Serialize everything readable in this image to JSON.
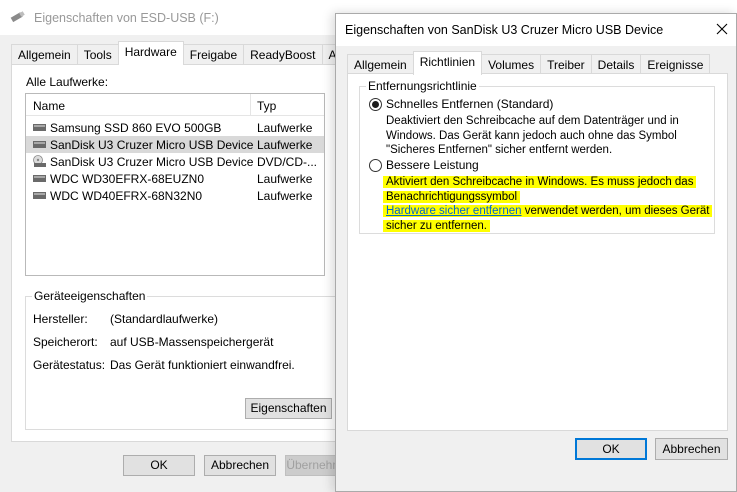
{
  "back_window": {
    "title": "Eigenschaften von ESD-USB (F:)",
    "tabs": [
      "Allgemein",
      "Tools",
      "Hardware",
      "Freigabe",
      "ReadyBoost",
      "Anpasse"
    ],
    "active_tab": "Hardware",
    "drives_label": "Alle Laufwerke:",
    "columns": [
      "Name",
      "Typ"
    ],
    "drives": [
      {
        "name": "Samsung SSD 860 EVO 500GB",
        "type": "Laufwerke",
        "icon": "drive-icon"
      },
      {
        "name": "SanDisk U3 Cruzer Micro USB Device",
        "type": "Laufwerke",
        "icon": "drive-icon",
        "selected": true
      },
      {
        "name": "SanDisk U3 Cruzer Micro USB Device",
        "type": "DVD/CD-...",
        "icon": "cd-drive-icon"
      },
      {
        "name": "WDC WD30EFRX-68EUZN0",
        "type": "Laufwerke",
        "icon": "drive-icon"
      },
      {
        "name": "WDC WD40EFRX-68N32N0",
        "type": "Laufwerke",
        "icon": "drive-icon"
      }
    ],
    "device_props": {
      "title": "Geräteeigenschaften",
      "manufacturer_label": "Hersteller:",
      "manufacturer_value": "(Standardlaufwerke)",
      "location_label": "Speicherort:",
      "location_value": "auf USB-Massenspeichergerät",
      "status_label": "Gerätestatus:",
      "status_value": "Das Gerät funktioniert einwandfrei.",
      "properties_button": "Eigenschaften"
    },
    "buttons": {
      "ok": "OK",
      "cancel": "Abbrechen",
      "apply": "Übernehmen"
    }
  },
  "front_window": {
    "title": "Eigenschaften von SanDisk U3 Cruzer Micro USB Device",
    "tabs": [
      "Allgemein",
      "Richtlinien",
      "Volumes",
      "Treiber",
      "Details",
      "Ereignisse"
    ],
    "active_tab": "Richtlinien",
    "group_title": "Entfernungsrichtlinie",
    "option1": {
      "label": "Schnelles Entfernen (Standard)",
      "selected": true,
      "desc_line1": "Deaktiviert den Schreibcache auf dem Datenträger und in",
      "desc_line2": "Windows. Das Gerät kann jedoch auch ohne das Symbol",
      "desc_line3": "\"Sicheres Entfernen\" sicher entfernt werden."
    },
    "option2": {
      "label": "Bessere Leistung",
      "selected": false,
      "desc_line1": "Aktiviert den Schreibcache in Windows. Es muss jedoch das",
      "desc_line2": "Benachrichtigungssymbol",
      "desc_link": "Hardware sicher entfernen",
      "desc_line3_rest": " verwendet werden, um dieses Gerät",
      "desc_line4": "sicher zu entfernen."
    },
    "buttons": {
      "ok": "OK",
      "cancel": "Abbrechen"
    }
  },
  "colors": {
    "highlight": "#ffff00",
    "link": "#0066cc",
    "accent": "#0078d7"
  }
}
